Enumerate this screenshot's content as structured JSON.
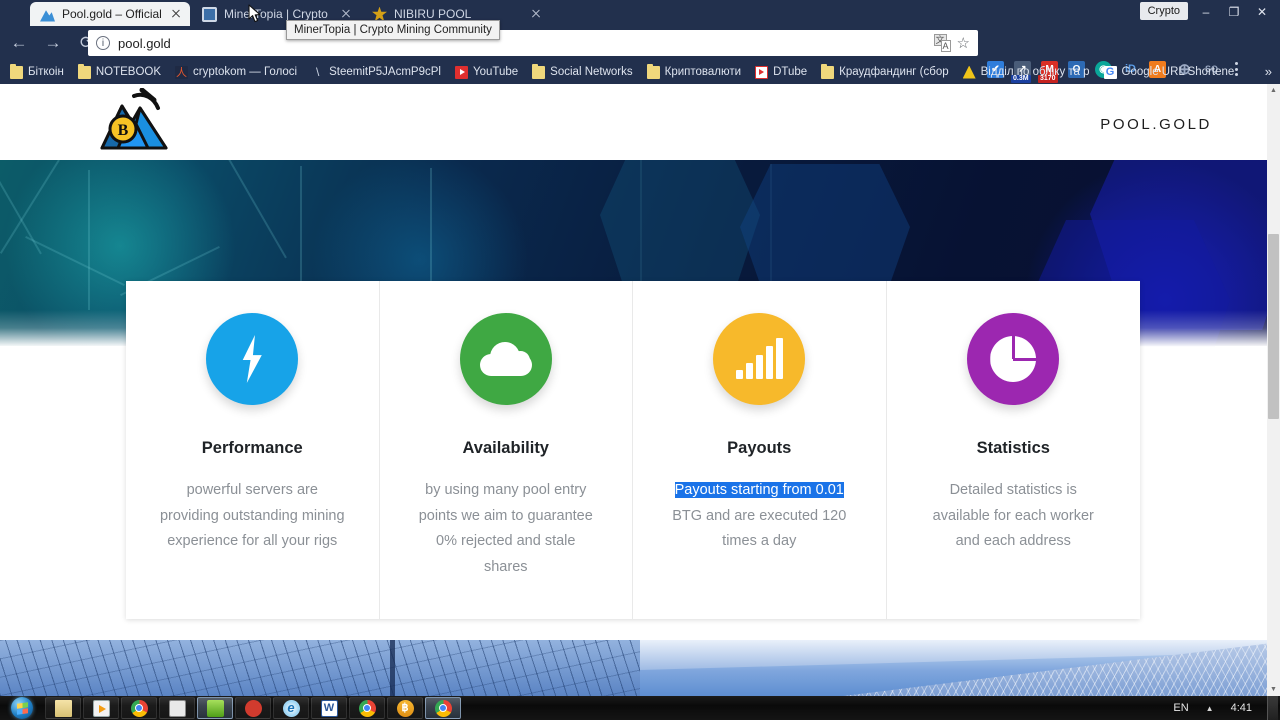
{
  "browser": {
    "tabs": [
      {
        "title": "Pool.gold – Official BTG",
        "favicon": "pool-gold-favicon",
        "active": true
      },
      {
        "title": "MinerTopia | Crypto Min",
        "favicon": "minertopia-favicon",
        "active": false
      },
      {
        "title": "NIBIRU POOL",
        "favicon": "nibiru-favicon",
        "active": false
      }
    ],
    "tooltip": "MinerTopia | Crypto Mining Community",
    "window_controls": {
      "minimize": "–",
      "maximize": "❐",
      "close": "✕",
      "profile_chip": "Crypto"
    },
    "nav": {
      "back": "←",
      "forward": "→",
      "reload": "⟳"
    },
    "omnibox": {
      "security_icon": "info-circle-icon",
      "url": "pool.gold",
      "translate_icon": "translate-icon",
      "bookmark_icon": "star-icon"
    },
    "extensions": [
      {
        "name": "checkmark-extension",
        "glyph": "✔",
        "color": "#2f7ddb",
        "badge": ""
      },
      {
        "name": "analytics-extension",
        "glyph": "↗",
        "color": "#4a5c78",
        "badge": "0.3M",
        "badge_color": "#1a3fa0"
      },
      {
        "name": "gmail-extension",
        "glyph": "M",
        "color": "#d93025",
        "badge": "3170",
        "badge_color": "#c5221f"
      },
      {
        "name": "office-extension",
        "glyph": "O",
        "color": "#2d6ab5",
        "badge": ""
      },
      {
        "name": "kaspersky-extension",
        "glyph": "◉",
        "color": "#0aa79a",
        "badge": ""
      },
      {
        "name": "identity-extension",
        "glyph": "iD",
        "color": "#2e7bd6",
        "badge": ""
      },
      {
        "name": "avast-extension",
        "glyph": "A",
        "color": "#f07c1e",
        "badge": ""
      },
      {
        "name": "globe-extension",
        "glyph": "⊕",
        "color": "#6b7a96",
        "badge": ""
      },
      {
        "name": "seoquake-extension",
        "glyph": "SQ",
        "color": "#5d6a85",
        "badge": ""
      }
    ],
    "menu_icon": "kebab-menu-icon",
    "bookmarks": [
      {
        "label": "Біткоін",
        "icon": "folder-icon"
      },
      {
        "label": "NOTEBOOK",
        "icon": "folder-icon"
      },
      {
        "label": "cryptokom — Голосі",
        "icon": "cryptokom-icon"
      },
      {
        "label": "SteemitP5JAcmP9cPl",
        "icon": "slash-icon"
      },
      {
        "label": "YouTube",
        "icon": "youtube-icon"
      },
      {
        "label": "Social Networks",
        "icon": "folder-icon"
      },
      {
        "label": "Криптовалюти",
        "icon": "folder-icon"
      },
      {
        "label": "DTube",
        "icon": "dtube-icon"
      },
      {
        "label": "Краудфандинг (сбор",
        "icon": "folder-icon"
      },
      {
        "label": "Відділ по обліку та p",
        "icon": "viddil-icon"
      },
      {
        "label": "Google URL Shortene",
        "icon": "google-icon"
      }
    ],
    "bookmarks_overflow": "»"
  },
  "page": {
    "logo_name": "pool-gold-mining-logo",
    "brand": "POOL.GOLD",
    "colors": {
      "performance": "#17a3e8",
      "availability": "#3fa843",
      "payouts": "#f7b92b",
      "statistics": "#9c27b0",
      "selection_highlight": "#1a73e8"
    },
    "cards": [
      {
        "icon": "lightning-bolt-icon",
        "icon_color": "#17a3e8",
        "title": "Performance",
        "text": "powerful servers are providing outstanding mining experience for all your rigs",
        "highlighted": ""
      },
      {
        "icon": "cloud-icon",
        "icon_color": "#3fa843",
        "title": "Availability",
        "text": "by using many pool entry points we aim to guarantee 0% rejected and stale shares",
        "highlighted": ""
      },
      {
        "icon": "bar-chart-icon",
        "icon_color": "#f7b92b",
        "title": "Payouts",
        "text_highlight": "Payouts starting from 0.01",
        "text_rest": " BTG and are executed 120 times a day",
        "highlighted": "Payouts starting from 0.01"
      },
      {
        "icon": "pie-chart-icon",
        "icon_color": "#9c27b0",
        "title": "Statistics",
        "text": "Detailed statistics is available for each worker and each address",
        "highlighted": ""
      }
    ],
    "scrollbar": {
      "up_arrow": "▲",
      "down_arrow": "▼"
    }
  },
  "taskbar": {
    "start_button": "start-orb",
    "buttons": [
      {
        "name": "taskbar-file-explorer",
        "icon": "folder-icon"
      },
      {
        "name": "taskbar-media-player",
        "icon": "media-player-icon"
      },
      {
        "name": "taskbar-chrome",
        "icon": "chrome-icon"
      },
      {
        "name": "taskbar-calculator",
        "icon": "calculator-icon"
      },
      {
        "name": "taskbar-green-app",
        "icon": "green-app-icon"
      },
      {
        "name": "taskbar-clock-app",
        "icon": "clock-app-icon"
      },
      {
        "name": "taskbar-internet-explorer",
        "icon": "internet-explorer-icon"
      },
      {
        "name": "taskbar-word",
        "icon": "word-icon"
      },
      {
        "name": "taskbar-chrome-window-1",
        "icon": "chrome-icon"
      },
      {
        "name": "taskbar-bitcoin-app",
        "icon": "bitcoin-icon"
      },
      {
        "name": "taskbar-chrome-window-2",
        "icon": "chrome-icon"
      }
    ],
    "tray": {
      "language": "EN",
      "arrow": "▲",
      "clock": "4:41"
    }
  }
}
